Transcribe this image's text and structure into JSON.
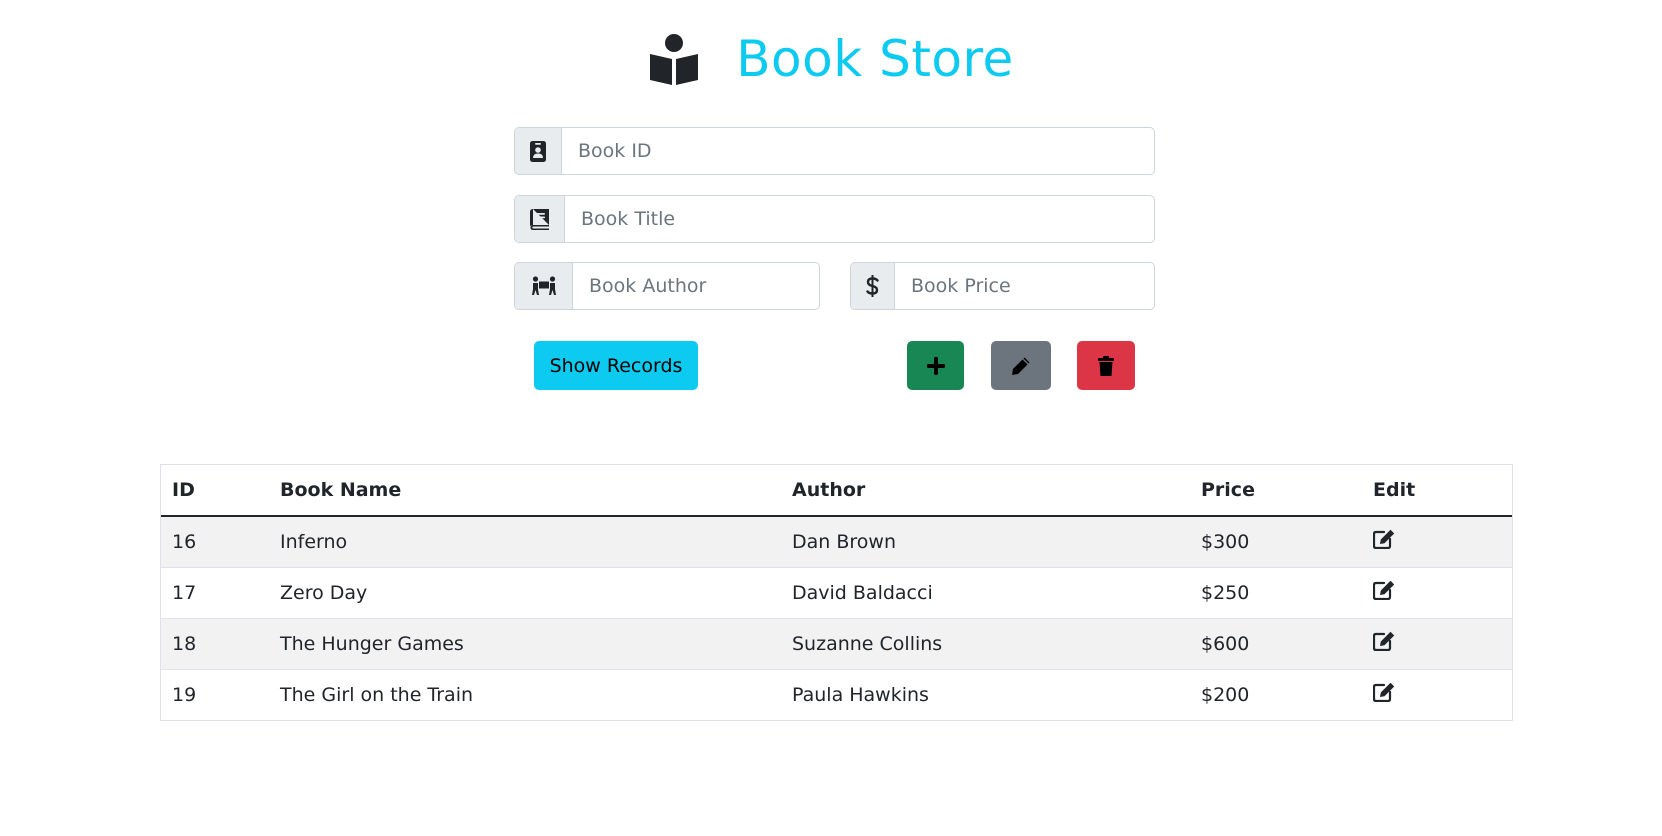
{
  "app": {
    "title": "Book Store",
    "logo_icon": "book-reader-icon",
    "accent_color": "#0dcaf0"
  },
  "form": {
    "book_id": {
      "placeholder": "Book ID",
      "value": "",
      "icon": "id-badge-icon"
    },
    "book_title": {
      "placeholder": "Book Title",
      "value": "",
      "icon": "book-icon"
    },
    "book_author": {
      "placeholder": "Book Author",
      "value": "",
      "icon": "people-carry-icon"
    },
    "book_price": {
      "placeholder": "Book Price",
      "value": "",
      "icon": "dollar-sign-icon"
    }
  },
  "actions": {
    "show_records_label": "Show Records",
    "add": {
      "icon": "plus-icon",
      "color": "#198754"
    },
    "edit": {
      "icon": "pencil-icon",
      "color": "#6c757d"
    },
    "delete": {
      "icon": "trash-icon",
      "color": "#dc3545"
    }
  },
  "table": {
    "headers": [
      "ID",
      "Book Name",
      "Author",
      "Price",
      "Edit"
    ],
    "rows": [
      {
        "id": "16",
        "name": "Inferno",
        "author": "Dan Brown",
        "price": "$300",
        "edit_icon": "edit-icon"
      },
      {
        "id": "17",
        "name": "Zero Day",
        "author": "David Baldacci",
        "price": "$250",
        "edit_icon": "edit-icon"
      },
      {
        "id": "18",
        "name": "The Hunger Games",
        "author": "Suzanne Collins",
        "price": "$600",
        "edit_icon": "edit-icon"
      },
      {
        "id": "19",
        "name": "The Girl on the Train",
        "author": "Paula Hawkins",
        "price": "$200",
        "edit_icon": "edit-icon"
      }
    ]
  }
}
